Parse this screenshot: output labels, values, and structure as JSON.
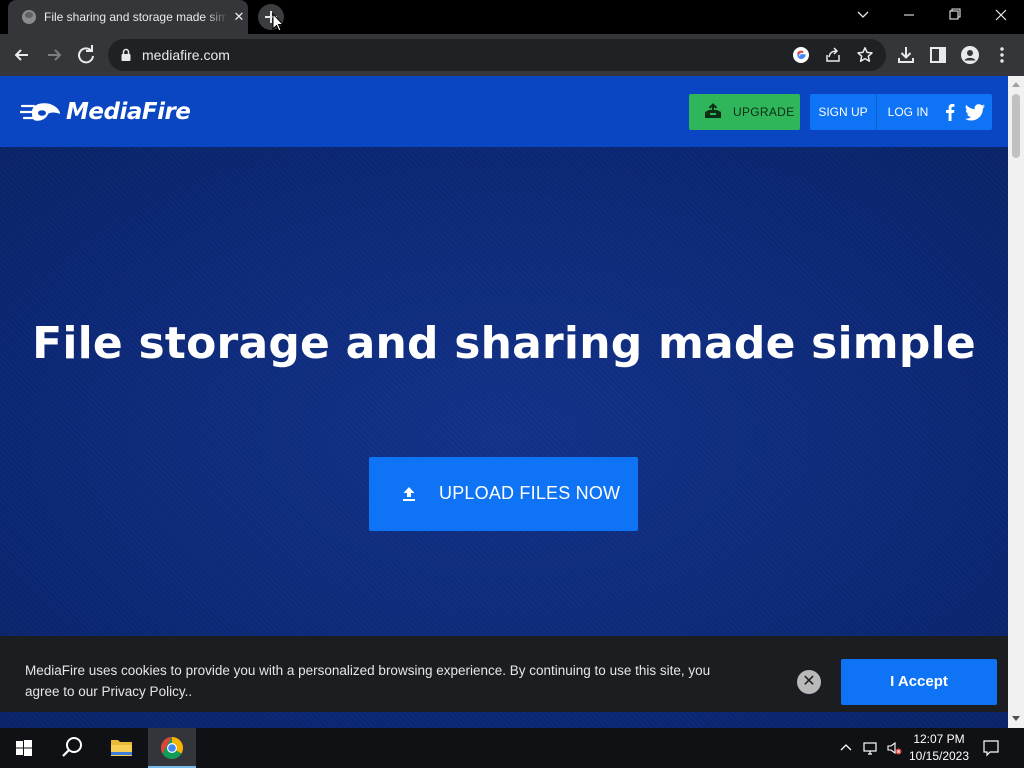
{
  "browser": {
    "tab_title": "File sharing and storage made simple",
    "url": "mediafire.com"
  },
  "site": {
    "logo_text": "MediaFire",
    "header": {
      "upgrade_label": "UPGRADE",
      "signup_label": "SIGN UP",
      "login_label": "LOG IN"
    },
    "hero": {
      "title": "File storage and sharing made simple",
      "upload_label": "UPLOAD FILES NOW"
    },
    "cookie": {
      "text": "MediaFire uses cookies to provide you with a personalized browsing experience. By continuing to use this site, you agree to our Privacy Policy..",
      "close_glyph": "✕",
      "accept_label": "I Accept"
    }
  },
  "taskbar": {
    "time": "12:07 PM",
    "date": "10/15/2023"
  },
  "icons": {
    "tab_close": "✕",
    "tab_search": "⌄",
    "win_min": "—",
    "win_max": "❐",
    "win_close": "✕"
  },
  "colors": {
    "brand_blue": "#0e73f4",
    "header_blue": "#0a46c2",
    "hero_navy": "#0b2774",
    "upgrade_green": "#2fb65a",
    "cookie_bg": "#1c1d21"
  }
}
